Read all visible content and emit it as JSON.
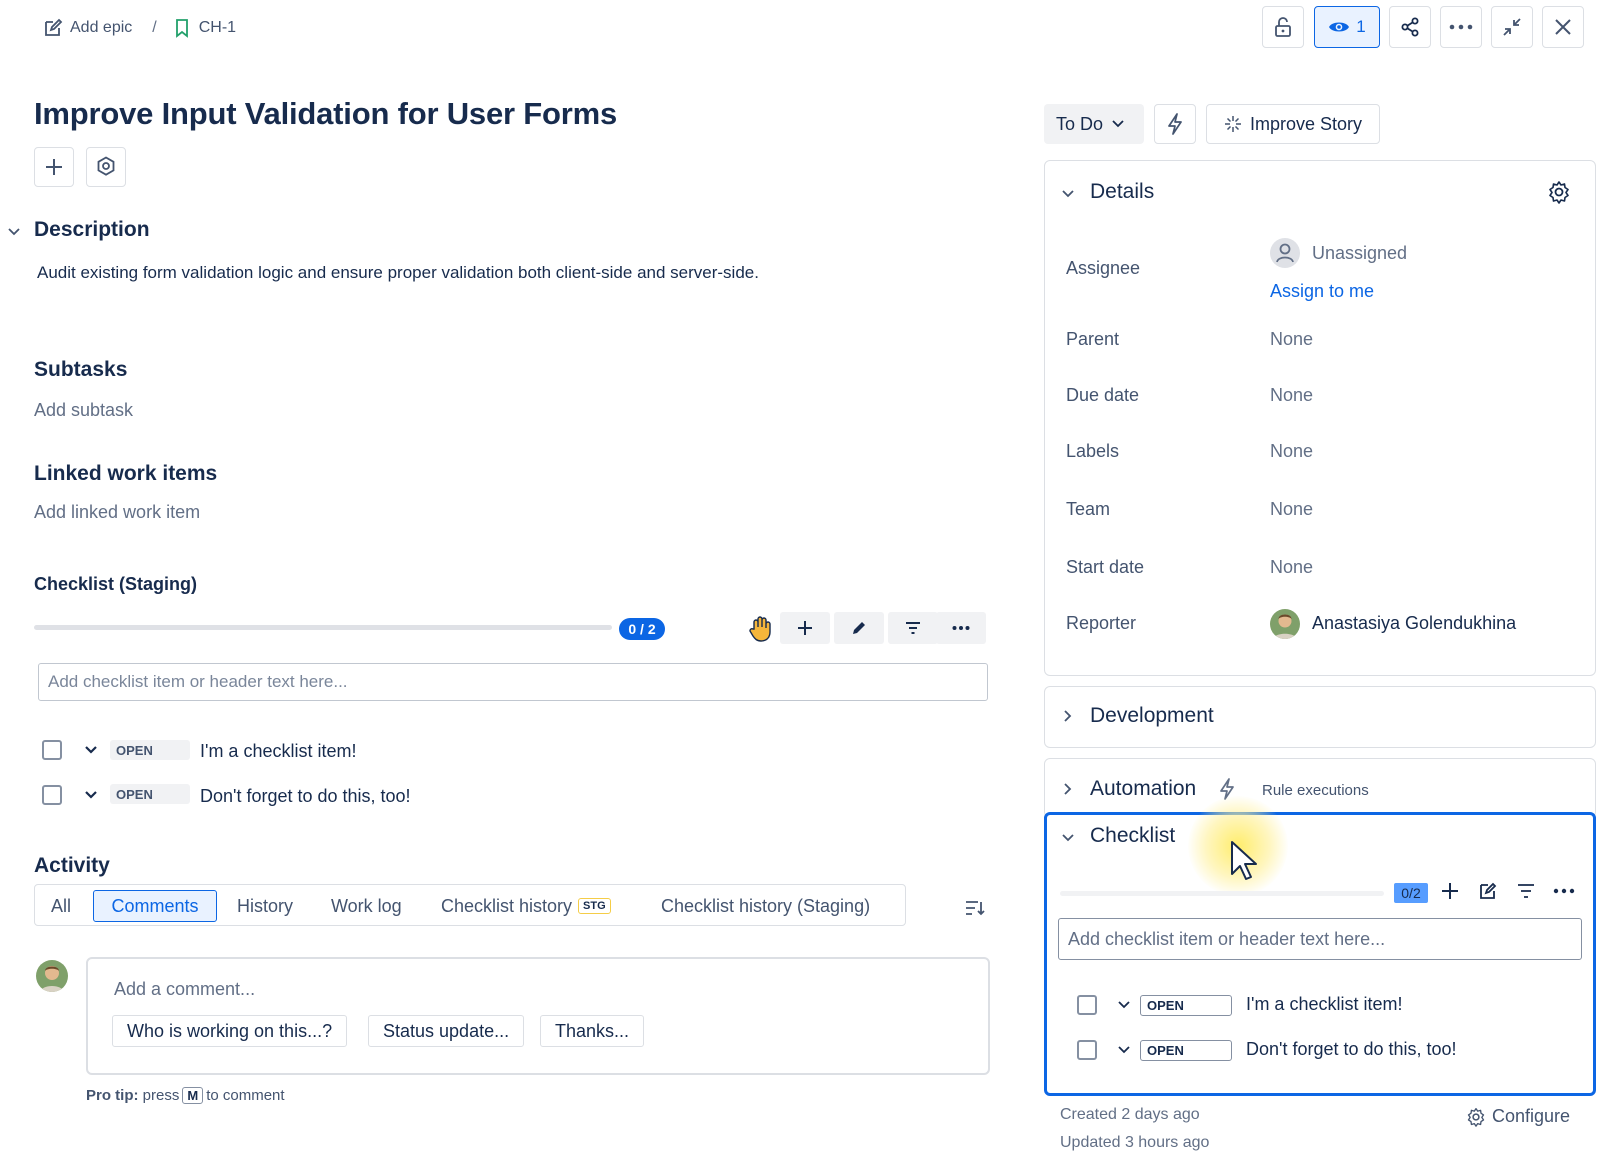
{
  "breadcrumb": {
    "epic_label": "Add epic",
    "separator": "/",
    "issue_key": "CH-1"
  },
  "topbar": {
    "watch_count": "1"
  },
  "issue": {
    "title": "Improve Input Validation for User Forms"
  },
  "description": {
    "heading": "Description",
    "text": "Audit existing form validation logic and ensure proper validation both client-side and server-side."
  },
  "subtasks": {
    "heading": "Subtasks",
    "add_label": "Add subtask"
  },
  "linked": {
    "heading": "Linked work items",
    "add_label": "Add linked work item"
  },
  "checklist_main": {
    "heading": "Checklist (Staging)",
    "progress": "0 / 2",
    "progress_fraction": 0,
    "input_placeholder": "Add checklist item or header text here...",
    "items": [
      {
        "status": "OPEN",
        "text": "I'm a checklist item!"
      },
      {
        "status": "OPEN",
        "text": "Don't forget to do this, too!"
      }
    ]
  },
  "activity": {
    "heading": "Activity",
    "tabs": [
      "All",
      "Comments",
      "History",
      "Work log",
      "Checklist history",
      "Checklist history (Staging)"
    ],
    "stg_badge": "STG",
    "selected_tab": "Comments",
    "comment_placeholder": "Add a comment...",
    "chips": [
      "Who is working on this...?",
      "Status update...",
      "Thanks..."
    ],
    "pro_tip_label": "Pro tip:",
    "pro_tip_press": "press",
    "pro_tip_key": "M",
    "pro_tip_rest": "to comment"
  },
  "actions": {
    "status": "To Do",
    "improve": "Improve Story"
  },
  "details": {
    "heading": "Details",
    "assignee_label": "Assignee",
    "assignee_value": "Unassigned",
    "assign_to_me": "Assign to me",
    "parent_label": "Parent",
    "parent_value": "None",
    "due_label": "Due date",
    "due_value": "None",
    "labels_label": "Labels",
    "labels_value": "None",
    "team_label": "Team",
    "team_value": "None",
    "start_label": "Start date",
    "start_value": "None",
    "reporter_label": "Reporter",
    "reporter_value": "Anastasiya Golendukhina"
  },
  "development": {
    "heading": "Development"
  },
  "automation": {
    "heading": "Automation",
    "rule_label": "Rule executions"
  },
  "checklist_side": {
    "heading": "Checklist",
    "progress": "0/2",
    "progress_fraction": 0,
    "input_placeholder": "Add checklist item or header text here...",
    "items": [
      {
        "status": "OPEN",
        "text": "I'm a checklist item!"
      },
      {
        "status": "OPEN",
        "text": "Don't forget to do this, too!"
      }
    ]
  },
  "meta": {
    "created": "Created 2 days ago",
    "updated": "Updated 3 hours ago",
    "configure": "Configure"
  },
  "colors": {
    "accent": "#0c66e4",
    "text": "#172b4d",
    "muted": "#626f86",
    "border": "#dcdfe4"
  }
}
